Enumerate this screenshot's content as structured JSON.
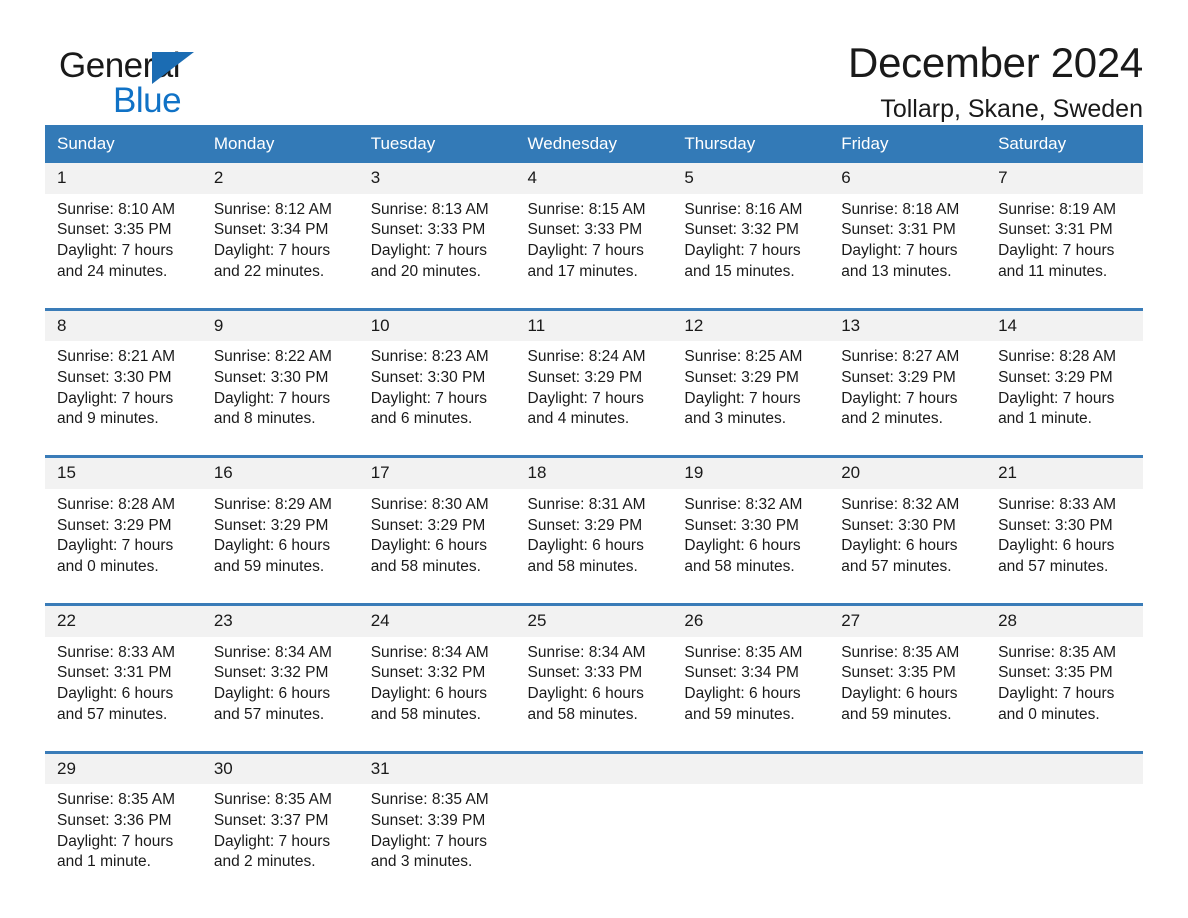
{
  "brand": {
    "name_part1": "General",
    "name_part2": "Blue",
    "accent_color": "#1072c6",
    "triangle_color": "#1b6cb3"
  },
  "header": {
    "title": "December 2024",
    "subtitle": "Tollarp, Skane, Sweden"
  },
  "theme": {
    "header_row_bg": "#337ab7",
    "daynum_bg": "#f2f2f2",
    "divider_color": "#3a7cb8",
    "text_color": "#1a1a1a"
  },
  "weekdays": [
    "Sunday",
    "Monday",
    "Tuesday",
    "Wednesday",
    "Thursday",
    "Friday",
    "Saturday"
  ],
  "weeks": [
    {
      "days": [
        {
          "num": "1",
          "sunrise": "Sunrise: 8:10 AM",
          "sunset": "Sunset: 3:35 PM",
          "daylight1": "Daylight: 7 hours",
          "daylight2": "and 24 minutes."
        },
        {
          "num": "2",
          "sunrise": "Sunrise: 8:12 AM",
          "sunset": "Sunset: 3:34 PM",
          "daylight1": "Daylight: 7 hours",
          "daylight2": "and 22 minutes."
        },
        {
          "num": "3",
          "sunrise": "Sunrise: 8:13 AM",
          "sunset": "Sunset: 3:33 PM",
          "daylight1": "Daylight: 7 hours",
          "daylight2": "and 20 minutes."
        },
        {
          "num": "4",
          "sunrise": "Sunrise: 8:15 AM",
          "sunset": "Sunset: 3:33 PM",
          "daylight1": "Daylight: 7 hours",
          "daylight2": "and 17 minutes."
        },
        {
          "num": "5",
          "sunrise": "Sunrise: 8:16 AM",
          "sunset": "Sunset: 3:32 PM",
          "daylight1": "Daylight: 7 hours",
          "daylight2": "and 15 minutes."
        },
        {
          "num": "6",
          "sunrise": "Sunrise: 8:18 AM",
          "sunset": "Sunset: 3:31 PM",
          "daylight1": "Daylight: 7 hours",
          "daylight2": "and 13 minutes."
        },
        {
          "num": "7",
          "sunrise": "Sunrise: 8:19 AM",
          "sunset": "Sunset: 3:31 PM",
          "daylight1": "Daylight: 7 hours",
          "daylight2": "and 11 minutes."
        }
      ]
    },
    {
      "days": [
        {
          "num": "8",
          "sunrise": "Sunrise: 8:21 AM",
          "sunset": "Sunset: 3:30 PM",
          "daylight1": "Daylight: 7 hours",
          "daylight2": "and 9 minutes."
        },
        {
          "num": "9",
          "sunrise": "Sunrise: 8:22 AM",
          "sunset": "Sunset: 3:30 PM",
          "daylight1": "Daylight: 7 hours",
          "daylight2": "and 8 minutes."
        },
        {
          "num": "10",
          "sunrise": "Sunrise: 8:23 AM",
          "sunset": "Sunset: 3:30 PM",
          "daylight1": "Daylight: 7 hours",
          "daylight2": "and 6 minutes."
        },
        {
          "num": "11",
          "sunrise": "Sunrise: 8:24 AM",
          "sunset": "Sunset: 3:29 PM",
          "daylight1": "Daylight: 7 hours",
          "daylight2": "and 4 minutes."
        },
        {
          "num": "12",
          "sunrise": "Sunrise: 8:25 AM",
          "sunset": "Sunset: 3:29 PM",
          "daylight1": "Daylight: 7 hours",
          "daylight2": "and 3 minutes."
        },
        {
          "num": "13",
          "sunrise": "Sunrise: 8:27 AM",
          "sunset": "Sunset: 3:29 PM",
          "daylight1": "Daylight: 7 hours",
          "daylight2": "and 2 minutes."
        },
        {
          "num": "14",
          "sunrise": "Sunrise: 8:28 AM",
          "sunset": "Sunset: 3:29 PM",
          "daylight1": "Daylight: 7 hours",
          "daylight2": "and 1 minute."
        }
      ]
    },
    {
      "days": [
        {
          "num": "15",
          "sunrise": "Sunrise: 8:28 AM",
          "sunset": "Sunset: 3:29 PM",
          "daylight1": "Daylight: 7 hours",
          "daylight2": "and 0 minutes."
        },
        {
          "num": "16",
          "sunrise": "Sunrise: 8:29 AM",
          "sunset": "Sunset: 3:29 PM",
          "daylight1": "Daylight: 6 hours",
          "daylight2": "and 59 minutes."
        },
        {
          "num": "17",
          "sunrise": "Sunrise: 8:30 AM",
          "sunset": "Sunset: 3:29 PM",
          "daylight1": "Daylight: 6 hours",
          "daylight2": "and 58 minutes."
        },
        {
          "num": "18",
          "sunrise": "Sunrise: 8:31 AM",
          "sunset": "Sunset: 3:29 PM",
          "daylight1": "Daylight: 6 hours",
          "daylight2": "and 58 minutes."
        },
        {
          "num": "19",
          "sunrise": "Sunrise: 8:32 AM",
          "sunset": "Sunset: 3:30 PM",
          "daylight1": "Daylight: 6 hours",
          "daylight2": "and 58 minutes."
        },
        {
          "num": "20",
          "sunrise": "Sunrise: 8:32 AM",
          "sunset": "Sunset: 3:30 PM",
          "daylight1": "Daylight: 6 hours",
          "daylight2": "and 57 minutes."
        },
        {
          "num": "21",
          "sunrise": "Sunrise: 8:33 AM",
          "sunset": "Sunset: 3:30 PM",
          "daylight1": "Daylight: 6 hours",
          "daylight2": "and 57 minutes."
        }
      ]
    },
    {
      "days": [
        {
          "num": "22",
          "sunrise": "Sunrise: 8:33 AM",
          "sunset": "Sunset: 3:31 PM",
          "daylight1": "Daylight: 6 hours",
          "daylight2": "and 57 minutes."
        },
        {
          "num": "23",
          "sunrise": "Sunrise: 8:34 AM",
          "sunset": "Sunset: 3:32 PM",
          "daylight1": "Daylight: 6 hours",
          "daylight2": "and 57 minutes."
        },
        {
          "num": "24",
          "sunrise": "Sunrise: 8:34 AM",
          "sunset": "Sunset: 3:32 PM",
          "daylight1": "Daylight: 6 hours",
          "daylight2": "and 58 minutes."
        },
        {
          "num": "25",
          "sunrise": "Sunrise: 8:34 AM",
          "sunset": "Sunset: 3:33 PM",
          "daylight1": "Daylight: 6 hours",
          "daylight2": "and 58 minutes."
        },
        {
          "num": "26",
          "sunrise": "Sunrise: 8:35 AM",
          "sunset": "Sunset: 3:34 PM",
          "daylight1": "Daylight: 6 hours",
          "daylight2": "and 59 minutes."
        },
        {
          "num": "27",
          "sunrise": "Sunrise: 8:35 AM",
          "sunset": "Sunset: 3:35 PM",
          "daylight1": "Daylight: 6 hours",
          "daylight2": "and 59 minutes."
        },
        {
          "num": "28",
          "sunrise": "Sunrise: 8:35 AM",
          "sunset": "Sunset: 3:35 PM",
          "daylight1": "Daylight: 7 hours",
          "daylight2": "and 0 minutes."
        }
      ]
    },
    {
      "days": [
        {
          "num": "29",
          "sunrise": "Sunrise: 8:35 AM",
          "sunset": "Sunset: 3:36 PM",
          "daylight1": "Daylight: 7 hours",
          "daylight2": "and 1 minute."
        },
        {
          "num": "30",
          "sunrise": "Sunrise: 8:35 AM",
          "sunset": "Sunset: 3:37 PM",
          "daylight1": "Daylight: 7 hours",
          "daylight2": "and 2 minutes."
        },
        {
          "num": "31",
          "sunrise": "Sunrise: 8:35 AM",
          "sunset": "Sunset: 3:39 PM",
          "daylight1": "Daylight: 7 hours",
          "daylight2": "and 3 minutes."
        },
        {
          "num": "",
          "sunrise": "",
          "sunset": "",
          "daylight1": "",
          "daylight2": ""
        },
        {
          "num": "",
          "sunrise": "",
          "sunset": "",
          "daylight1": "",
          "daylight2": ""
        },
        {
          "num": "",
          "sunrise": "",
          "sunset": "",
          "daylight1": "",
          "daylight2": ""
        },
        {
          "num": "",
          "sunrise": "",
          "sunset": "",
          "daylight1": "",
          "daylight2": ""
        }
      ]
    }
  ]
}
